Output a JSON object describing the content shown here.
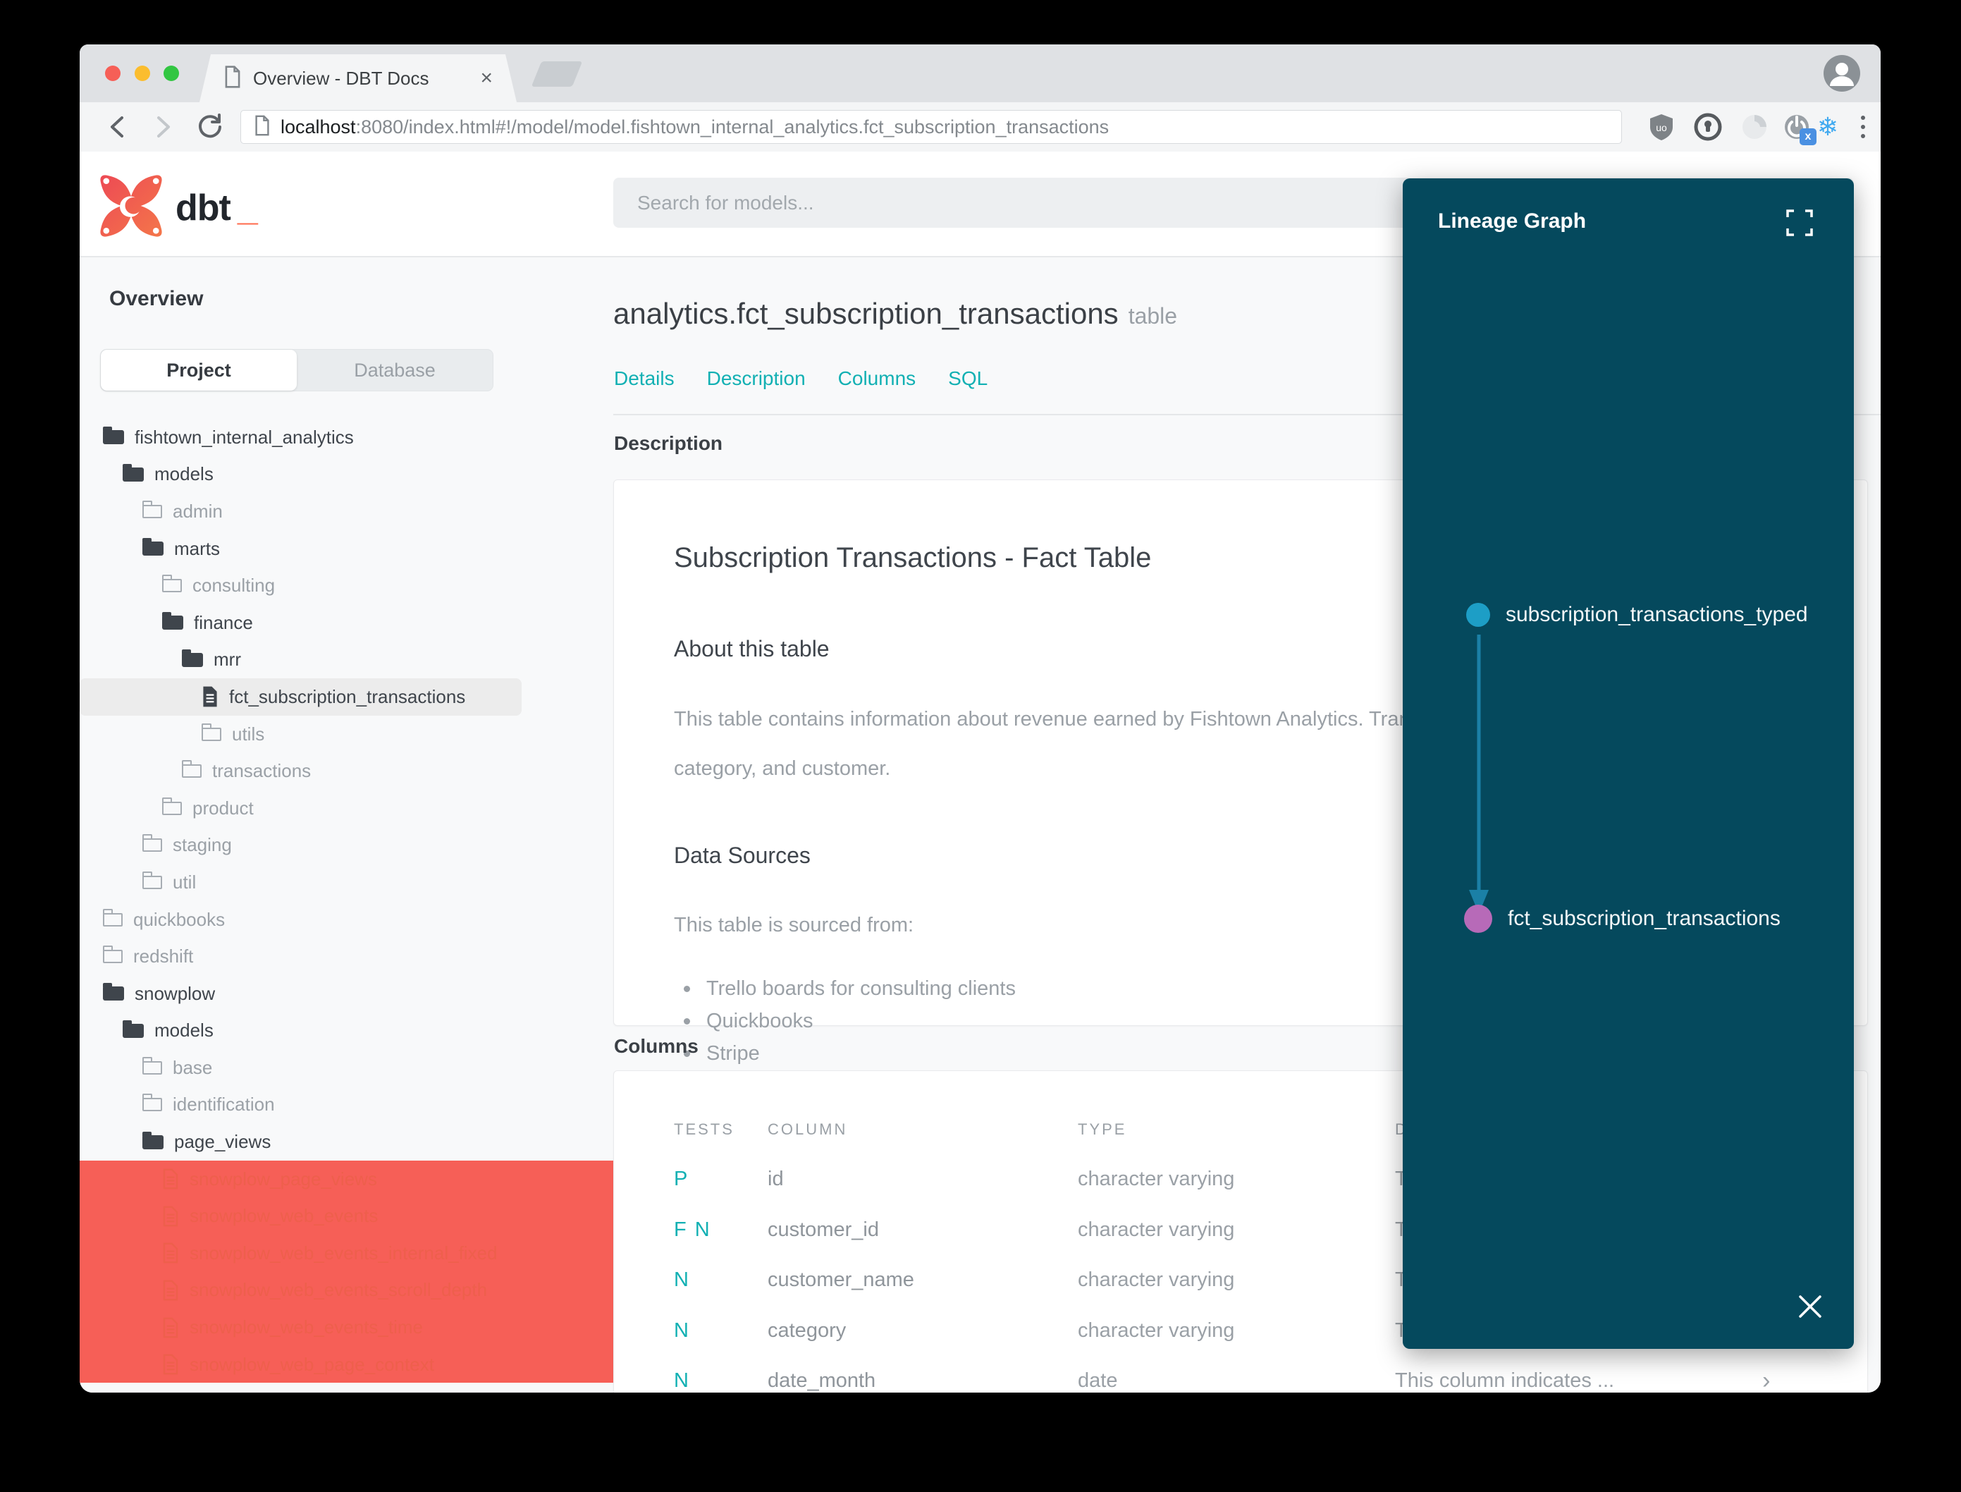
{
  "browser": {
    "tab_title": "Overview - DBT Docs",
    "tab_close": "×",
    "url_host": "localhost",
    "url_rest": ":8080/index.html#!/model/model.fishtown_internal_analytics.fct_subscription_transactions",
    "ublock_label": "uo",
    "ext_badge": "x",
    "snowflake_glyph": "❄"
  },
  "header": {
    "logo_text": "dbt",
    "logo_underscore": "_",
    "search_placeholder": "Search for models..."
  },
  "sidebar": {
    "overview_label": "Overview",
    "toggle": {
      "project": "Project",
      "database": "Database"
    },
    "tree": [
      {
        "label": "fishtown_internal_analytics",
        "type": "folder-open",
        "level": 0
      },
      {
        "label": "models",
        "type": "folder-open",
        "level": 1
      },
      {
        "label": "admin",
        "type": "folder-closed",
        "level": 2
      },
      {
        "label": "marts",
        "type": "folder-open",
        "level": 2
      },
      {
        "label": "consulting",
        "type": "folder-closed",
        "level": 3
      },
      {
        "label": "finance",
        "type": "folder-open",
        "level": 3
      },
      {
        "label": "mrr",
        "type": "folder-open",
        "level": 4
      },
      {
        "label": "fct_subscription_transactions",
        "type": "file",
        "level": 5,
        "selected": true
      },
      {
        "label": "utils",
        "type": "folder-closed",
        "level": 5
      },
      {
        "label": "transactions",
        "type": "folder-closed",
        "level": 4
      },
      {
        "label": "product",
        "type": "folder-closed",
        "level": 3
      },
      {
        "label": "staging",
        "type": "folder-closed",
        "level": 2
      },
      {
        "label": "util",
        "type": "folder-closed",
        "level": 2
      },
      {
        "label": "quickbooks",
        "type": "folder-closed",
        "level": 0
      },
      {
        "label": "redshift",
        "type": "folder-closed",
        "level": 0
      },
      {
        "label": "snowplow",
        "type": "folder-open",
        "level": 0
      },
      {
        "label": "models",
        "type": "folder-open",
        "level": 1
      },
      {
        "label": "base",
        "type": "folder-closed",
        "level": 2
      },
      {
        "label": "identification",
        "type": "folder-closed",
        "level": 2
      },
      {
        "label": "page_views",
        "type": "folder-open",
        "level": 2
      },
      {
        "label": "snowplow_page_views",
        "type": "file-red",
        "level": 3
      },
      {
        "label": "snowplow_web_events",
        "type": "file-red",
        "level": 3
      },
      {
        "label": "snowplow_web_events_internal_fixed",
        "type": "file-red",
        "level": 3
      },
      {
        "label": "snowplow_web_events_scroll_depth",
        "type": "file-red",
        "level": 3
      },
      {
        "label": "snowplow_web_events_time",
        "type": "file-red",
        "level": 3
      },
      {
        "label": "snowplow_web_page_context",
        "type": "file-red",
        "level": 3
      }
    ]
  },
  "main": {
    "title": "analytics.fct_subscription_transactions",
    "title_badge": "table",
    "tabs": [
      {
        "label": "Details"
      },
      {
        "label": "Description"
      },
      {
        "label": "Columns"
      },
      {
        "label": "SQL"
      }
    ],
    "description_label": "Description",
    "description_card": {
      "title": "Subscription Transactions - Fact Table",
      "about_heading": "About this table",
      "about_line1": "This table contains information about revenue earned by Fishtown Analytics. Trans",
      "about_line2": "category, and customer.",
      "sources_heading": "Data Sources",
      "sources_intro": "This table is sourced from:",
      "sources": [
        {
          "label": "Trello boards for consulting clients"
        },
        {
          "label": "Quickbooks"
        },
        {
          "label": "Stripe"
        }
      ]
    },
    "columns_label": "Columns",
    "columns_table": {
      "headers": [
        "TESTS",
        "COLUMN",
        "TYPE",
        "DESCRIPTION"
      ],
      "rows": [
        {
          "tests": "P",
          "column": "id",
          "type": "character varying",
          "description": "T"
        },
        {
          "tests": "F N",
          "column": "customer_id",
          "type": "character varying",
          "description": "T"
        },
        {
          "tests": "N",
          "column": "customer_name",
          "type": "character varying",
          "description": "T"
        },
        {
          "tests": "N",
          "column": "category",
          "type": "character varying",
          "description": "T"
        },
        {
          "tests": "N",
          "column": "date_month",
          "type": "date",
          "description": "This column indicates ...",
          "chevron": "›"
        }
      ]
    }
  },
  "lineage": {
    "title": "Lineage Graph",
    "nodes": [
      {
        "label": "subscription_transactions_typed",
        "color": "#1d9ec6"
      },
      {
        "label": "fct_subscription_transactions",
        "color": "#b76ab8"
      }
    ]
  },
  "colors": {
    "accent_teal": "#12b0b3",
    "model_red": "#ee5f4c",
    "logo_orange": "#ff694b",
    "lineage_bg": "#05495d",
    "lineage_source_node": "#1d9ec6",
    "lineage_target_node": "#b76ab8",
    "lineage_edge": "#1b80a6"
  }
}
